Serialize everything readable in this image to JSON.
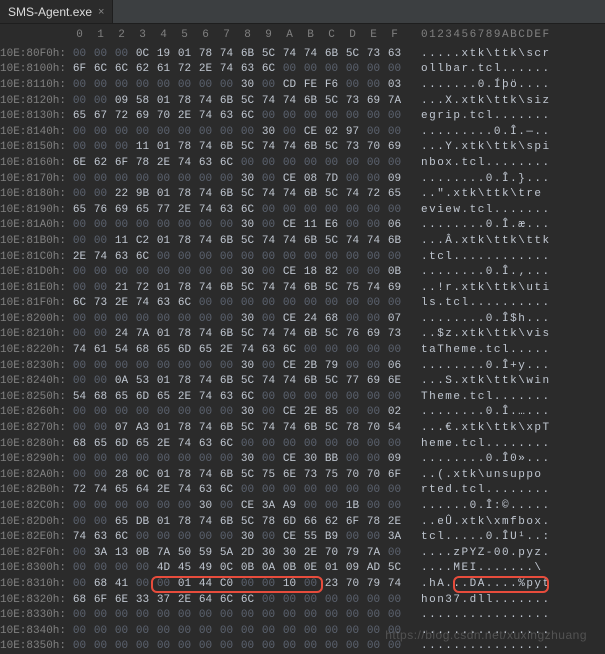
{
  "tab": {
    "title": "SMS-Agent.exe",
    "close": "×"
  },
  "col_header": {
    "hex": [
      "0",
      "1",
      "2",
      "3",
      "4",
      "5",
      "6",
      "7",
      "8",
      "9",
      "A",
      "B",
      "C",
      "D",
      "E",
      "F"
    ],
    "ascii": "0123456789ABCDEF"
  },
  "rows": [
    {
      "addr": "10E:80F0h:",
      "hex": [
        "00",
        "00",
        "00",
        "0C",
        "19",
        "01",
        "78",
        "74",
        "6B",
        "5C",
        "74",
        "74",
        "6B",
        "5C",
        "73",
        "63"
      ],
      "ascii": ".....xtk\\ttk\\scr"
    },
    {
      "addr": "10E:8100h:",
      "hex": [
        "6F",
        "6C",
        "6C",
        "62",
        "61",
        "72",
        "2E",
        "74",
        "63",
        "6C",
        "00",
        "00",
        "00",
        "00",
        "00",
        "00"
      ],
      "ascii": "ollbar.tcl......"
    },
    {
      "addr": "10E:8110h:",
      "hex": [
        "00",
        "00",
        "00",
        "00",
        "00",
        "00",
        "00",
        "00",
        "30",
        "00",
        "CD",
        "FE",
        "F6",
        "00",
        "00",
        "03"
      ],
      "ascii": ".......0.Íþö...."
    },
    {
      "addr": "10E:8120h:",
      "hex": [
        "00",
        "00",
        "09",
        "58",
        "01",
        "78",
        "74",
        "6B",
        "5C",
        "74",
        "74",
        "6B",
        "5C",
        "73",
        "69",
        "7A"
      ],
      "ascii": "...X.xtk\\ttk\\siz"
    },
    {
      "addr": "10E:8130h:",
      "hex": [
        "65",
        "67",
        "72",
        "69",
        "70",
        "2E",
        "74",
        "63",
        "6C",
        "00",
        "00",
        "00",
        "00",
        "00",
        "00",
        "00"
      ],
      "ascii": "egrip.tcl......."
    },
    {
      "addr": "10E:8140h:",
      "hex": [
        "00",
        "00",
        "00",
        "00",
        "00",
        "00",
        "00",
        "00",
        "00",
        "30",
        "00",
        "CE",
        "02",
        "97",
        "00",
        "00"
      ],
      "ascii": ".........0.Î.—.."
    },
    {
      "addr": "10E:8150h:",
      "hex": [
        "00",
        "00",
        "00",
        "11",
        "01",
        "78",
        "74",
        "6B",
        "5C",
        "74",
        "74",
        "6B",
        "5C",
        "73",
        "70",
        "69"
      ],
      "ascii": "...Y.xtk\\ttk\\spi"
    },
    {
      "addr": "10E:8160h:",
      "hex": [
        "6E",
        "62",
        "6F",
        "78",
        "2E",
        "74",
        "63",
        "6C",
        "00",
        "00",
        "00",
        "00",
        "00",
        "00",
        "00",
        "00"
      ],
      "ascii": "nbox.tcl........"
    },
    {
      "addr": "10E:8170h:",
      "hex": [
        "00",
        "00",
        "00",
        "00",
        "00",
        "00",
        "00",
        "00",
        "30",
        "00",
        "CE",
        "08",
        "7D",
        "00",
        "00",
        "09"
      ],
      "ascii": "........0.Î.}..."
    },
    {
      "addr": "10E:8180h:",
      "hex": [
        "00",
        "00",
        "22",
        "9B",
        "01",
        "78",
        "74",
        "6B",
        "5C",
        "74",
        "74",
        "6B",
        "5C",
        "74",
        "72",
        "65"
      ],
      "ascii": "..\".xtk\\ttk\\tre"
    },
    {
      "addr": "10E:8190h:",
      "hex": [
        "65",
        "76",
        "69",
        "65",
        "77",
        "2E",
        "74",
        "63",
        "6C",
        "00",
        "00",
        "00",
        "00",
        "00",
        "00",
        "00"
      ],
      "ascii": "eview.tcl......."
    },
    {
      "addr": "10E:81A0h:",
      "hex": [
        "00",
        "00",
        "00",
        "00",
        "00",
        "00",
        "00",
        "00",
        "30",
        "00",
        "CE",
        "11",
        "E6",
        "00",
        "00",
        "06"
      ],
      "ascii": "........0.Î.æ..."
    },
    {
      "addr": "10E:81B0h:",
      "hex": [
        "00",
        "00",
        "11",
        "C2",
        "01",
        "78",
        "74",
        "6B",
        "5C",
        "74",
        "74",
        "6B",
        "5C",
        "74",
        "74",
        "6B"
      ],
      "ascii": "...Â.xtk\\ttk\\ttk"
    },
    {
      "addr": "10E:81C0h:",
      "hex": [
        "2E",
        "74",
        "63",
        "6C",
        "00",
        "00",
        "00",
        "00",
        "00",
        "00",
        "00",
        "00",
        "00",
        "00",
        "00",
        "00"
      ],
      "ascii": ".tcl............"
    },
    {
      "addr": "10E:81D0h:",
      "hex": [
        "00",
        "00",
        "00",
        "00",
        "00",
        "00",
        "00",
        "00",
        "30",
        "00",
        "CE",
        "18",
        "82",
        "00",
        "00",
        "0B"
      ],
      "ascii": "........0.Î.‚..."
    },
    {
      "addr": "10E:81E0h:",
      "hex": [
        "00",
        "00",
        "21",
        "72",
        "01",
        "78",
        "74",
        "6B",
        "5C",
        "74",
        "74",
        "6B",
        "5C",
        "75",
        "74",
        "69"
      ],
      "ascii": "..!r.xtk\\ttk\\uti"
    },
    {
      "addr": "10E:81F0h:",
      "hex": [
        "6C",
        "73",
        "2E",
        "74",
        "63",
        "6C",
        "00",
        "00",
        "00",
        "00",
        "00",
        "00",
        "00",
        "00",
        "00",
        "00"
      ],
      "ascii": "ls.tcl.........."
    },
    {
      "addr": "10E:8200h:",
      "hex": [
        "00",
        "00",
        "00",
        "00",
        "00",
        "00",
        "00",
        "00",
        "30",
        "00",
        "CE",
        "24",
        "68",
        "00",
        "00",
        "07"
      ],
      "ascii": "........0.Î$h..."
    },
    {
      "addr": "10E:8210h:",
      "hex": [
        "00",
        "00",
        "24",
        "7A",
        "01",
        "78",
        "74",
        "6B",
        "5C",
        "74",
        "74",
        "6B",
        "5C",
        "76",
        "69",
        "73"
      ],
      "ascii": "..$z.xtk\\ttk\\vis"
    },
    {
      "addr": "10E:8220h:",
      "hex": [
        "74",
        "61",
        "54",
        "68",
        "65",
        "6D",
        "65",
        "2E",
        "74",
        "63",
        "6C",
        "00",
        "00",
        "00",
        "00",
        "00"
      ],
      "ascii": "taTheme.tcl....."
    },
    {
      "addr": "10E:8230h:",
      "hex": [
        "00",
        "00",
        "00",
        "00",
        "00",
        "00",
        "00",
        "00",
        "30",
        "00",
        "CE",
        "2B",
        "79",
        "00",
        "00",
        "06"
      ],
      "ascii": "........0.Î+y..."
    },
    {
      "addr": "10E:8240h:",
      "hex": [
        "00",
        "00",
        "0A",
        "53",
        "01",
        "78",
        "74",
        "6B",
        "5C",
        "74",
        "74",
        "6B",
        "5C",
        "77",
        "69",
        "6E"
      ],
      "ascii": "...S.xtk\\ttk\\win"
    },
    {
      "addr": "10E:8250h:",
      "hex": [
        "54",
        "68",
        "65",
        "6D",
        "65",
        "2E",
        "74",
        "63",
        "6C",
        "00",
        "00",
        "00",
        "00",
        "00",
        "00",
        "00"
      ],
      "ascii": "Theme.tcl......."
    },
    {
      "addr": "10E:8260h:",
      "hex": [
        "00",
        "00",
        "00",
        "00",
        "00",
        "00",
        "00",
        "00",
        "30",
        "00",
        "CE",
        "2E",
        "85",
        "00",
        "00",
        "02"
      ],
      "ascii": "........0.Î.…..."
    },
    {
      "addr": "10E:8270h:",
      "hex": [
        "00",
        "00",
        "07",
        "A3",
        "01",
        "78",
        "74",
        "6B",
        "5C",
        "74",
        "74",
        "6B",
        "5C",
        "78",
        "70",
        "54"
      ],
      "ascii": "...€.xtk\\ttk\\xpT"
    },
    {
      "addr": "10E:8280h:",
      "hex": [
        "68",
        "65",
        "6D",
        "65",
        "2E",
        "74",
        "63",
        "6C",
        "00",
        "00",
        "00",
        "00",
        "00",
        "00",
        "00",
        "00"
      ],
      "ascii": "heme.tcl........"
    },
    {
      "addr": "10E:8290h:",
      "hex": [
        "00",
        "00",
        "00",
        "00",
        "00",
        "00",
        "00",
        "00",
        "30",
        "00",
        "CE",
        "30",
        "BB",
        "00",
        "00",
        "09"
      ],
      "ascii": "........0.Î0»..."
    },
    {
      "addr": "10E:82A0h:",
      "hex": [
        "00",
        "00",
        "28",
        "0C",
        "01",
        "78",
        "74",
        "6B",
        "5C",
        "75",
        "6E",
        "73",
        "75",
        "70",
        "70",
        "6F"
      ],
      "ascii": "..(.xtk\\unsuppo"
    },
    {
      "addr": "10E:82B0h:",
      "hex": [
        "72",
        "74",
        "65",
        "64",
        "2E",
        "74",
        "63",
        "6C",
        "00",
        "00",
        "00",
        "00",
        "00",
        "00",
        "00",
        "00"
      ],
      "ascii": "rted.tcl........"
    },
    {
      "addr": "10E:82C0h:",
      "hex": [
        "00",
        "00",
        "00",
        "00",
        "00",
        "00",
        "30",
        "00",
        "CE",
        "3A",
        "A9",
        "00",
        "00",
        "1B",
        "00",
        "00"
      ],
      "ascii": "......0.Î:©....."
    },
    {
      "addr": "10E:82D0h:",
      "hex": [
        "00",
        "00",
        "65",
        "DB",
        "01",
        "78",
        "74",
        "6B",
        "5C",
        "78",
        "6D",
        "66",
        "62",
        "6F",
        "78",
        "2E"
      ],
      "ascii": "..eÛ.xtk\\xmfbox."
    },
    {
      "addr": "10E:82E0h:",
      "hex": [
        "74",
        "63",
        "6C",
        "00",
        "00",
        "00",
        "00",
        "00",
        "30",
        "00",
        "CE",
        "55",
        "B9",
        "00",
        "00",
        "3A"
      ],
      "ascii": "tcl.....0.ÎU¹..:"
    },
    {
      "addr": "10E:82F0h:",
      "hex": [
        "00",
        "3A",
        "13",
        "0B",
        "7A",
        "50",
        "59",
        "5A",
        "2D",
        "30",
        "30",
        "2E",
        "70",
        "79",
        "7A",
        "00"
      ],
      "ascii": "....zPYZ-00.pyz."
    },
    {
      "addr": "10E:8300h:",
      "hex": [
        "00",
        "00",
        "00",
        "00",
        "4D",
        "45",
        "49",
        "0C",
        "0B",
        "0A",
        "0B",
        "0E",
        "01",
        "09",
        "AD",
        "5C"
      ],
      "ascii": "....MEI.......­\\"
    },
    {
      "addr": "10E:8310h:",
      "hex": [
        "00",
        "68",
        "41",
        "00",
        "00",
        "01",
        "44",
        "C0",
        "00",
        "00",
        "10",
        "00",
        "23",
        "70",
        "79",
        "74"
      ],
      "ascii": ".hA...DÀ....%pyt"
    },
    {
      "addr": "10E:8320h:",
      "hex": [
        "68",
        "6F",
        "6E",
        "33",
        "37",
        "2E",
        "64",
        "6C",
        "6C",
        "00",
        "00",
        "00",
        "00",
        "00",
        "00",
        "00"
      ],
      "ascii": "hon37.dll......."
    },
    {
      "addr": "10E:8330h:",
      "hex": [
        "00",
        "00",
        "00",
        "00",
        "00",
        "00",
        "00",
        "00",
        "00",
        "00",
        "00",
        "00",
        "00",
        "00",
        "00",
        "00"
      ],
      "ascii": "................"
    },
    {
      "addr": "10E:8340h:",
      "hex": [
        "00",
        "00",
        "00",
        "00",
        "00",
        "00",
        "00",
        "00",
        "00",
        "00",
        "00",
        "00",
        "00",
        "00",
        "00",
        "00"
      ],
      "ascii": "................"
    },
    {
      "addr": "10E:8350h:",
      "hex": [
        "00",
        "00",
        "00",
        "00",
        "00",
        "00",
        "00",
        "00",
        "00",
        "00",
        "00",
        "00",
        "00",
        "00",
        "00",
        "00"
      ],
      "ascii": "................"
    }
  ],
  "watermark": "https://blog.csdn.net/xuxingzhuang"
}
